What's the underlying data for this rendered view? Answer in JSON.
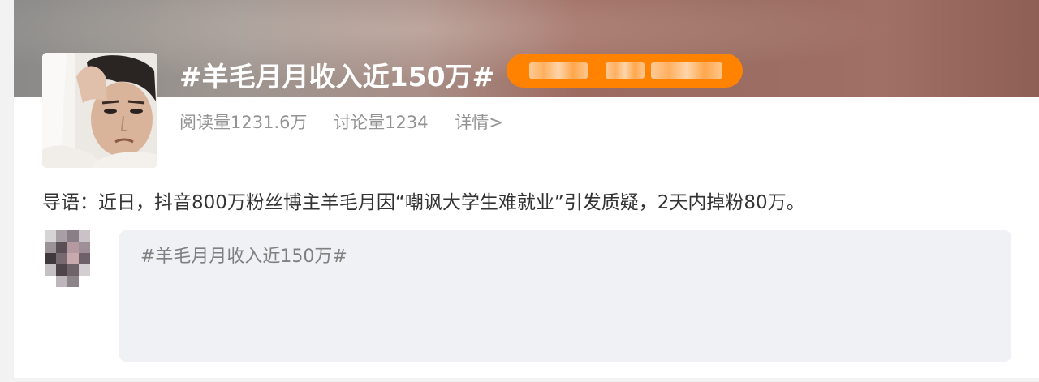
{
  "topic": {
    "title": "#羊毛月月收入近150万#",
    "stats": {
      "reads": "阅读量1231.6万",
      "discussions": "讨论量1234",
      "details_link": "详情>"
    },
    "lead": "导语：近日，抖音800万粉丝博主羊毛月因“嘲讽大学生难就业”引发质疑，2天内掉粉80万。"
  },
  "composer": {
    "placeholder": "#羊毛月月收入近150万#"
  },
  "colors": {
    "accent_orange": "#ff8200",
    "composer_bg": "#f0f1f4",
    "muted_text": "#939393"
  },
  "icons": {
    "topic_avatar": "topic-avatar-image",
    "user_avatar": "user-avatar-image"
  }
}
